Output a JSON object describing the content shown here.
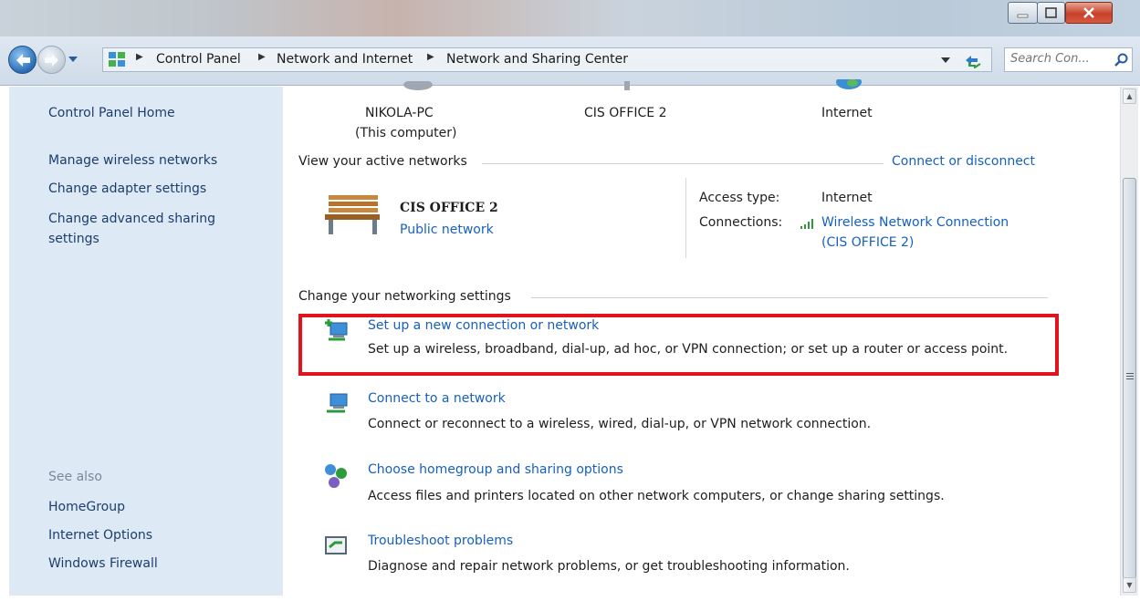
{
  "window": {
    "minimize": "–",
    "maximize": "□",
    "close": "x"
  },
  "breadcrumb": {
    "items": [
      "Control Panel",
      "Network and Internet",
      "Network and Sharing Center"
    ]
  },
  "search": {
    "placeholder": "Search Con..."
  },
  "sidebar": {
    "items": [
      {
        "label": "Control Panel Home"
      },
      {
        "label": "Manage wireless networks"
      },
      {
        "label": "Change adapter settings"
      },
      {
        "label": "Change advanced sharing"
      },
      {
        "label": "settings"
      }
    ],
    "see_also_label": "See also",
    "see_also": [
      {
        "label": "HomeGroup"
      },
      {
        "label": "Internet Options"
      },
      {
        "label": "Windows Firewall"
      }
    ]
  },
  "map": {
    "computer_name": "NIKOLA-PC",
    "computer_sub": "(This computer)",
    "network_name": "CIS OFFICE 2",
    "internet_label": "Internet"
  },
  "active": {
    "heading": "View your active networks",
    "connect_link": "Connect or disconnect",
    "network_name": "CIS OFFICE 2",
    "network_type": "Public network",
    "access_type_label": "Access type:",
    "access_type_value": "Internet",
    "connections_label": "Connections:",
    "connection_link_1": "Wireless Network Connection",
    "connection_link_2": "(CIS OFFICE 2)"
  },
  "settings": {
    "heading": "Change your networking settings",
    "tasks": [
      {
        "title": "Set up a new connection or network",
        "desc": "Set up a wireless, broadband, dial-up, ad hoc, or VPN connection; or set up a router or access point.",
        "icon": "new-connection-icon"
      },
      {
        "title": "Connect to a network",
        "desc": "Connect or reconnect to a wireless, wired, dial-up, or VPN network connection.",
        "icon": "connect-network-icon"
      },
      {
        "title": "Choose homegroup and sharing options",
        "desc": "Access files and printers located on other network computers, or change sharing settings.",
        "icon": "homegroup-icon"
      },
      {
        "title": "Troubleshoot problems",
        "desc": "Diagnose and repair network problems, or get troubleshooting information.",
        "icon": "troubleshoot-icon"
      }
    ]
  },
  "colors": {
    "highlight_box": "#e1141e",
    "link": "#1660c0",
    "sidebar_bg": "#dde9f5"
  }
}
